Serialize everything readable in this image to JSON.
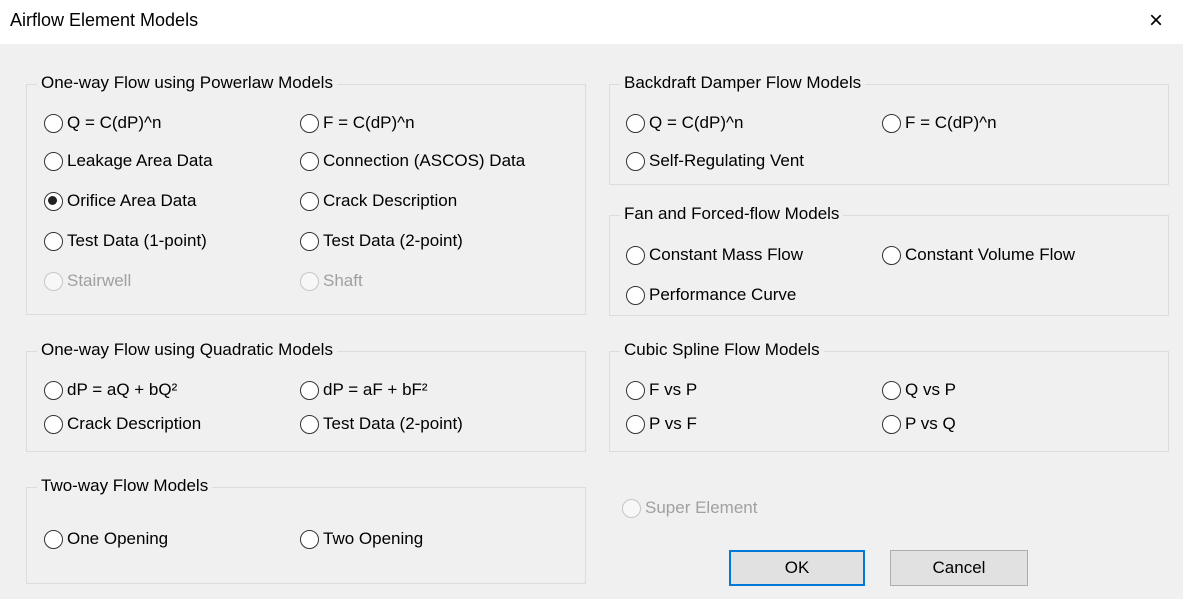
{
  "window": {
    "title": "Airflow Element Models",
    "close_icon": "×"
  },
  "groups": {
    "powerlaw": {
      "title": "One-way Flow using Powerlaw Models",
      "options": [
        {
          "label": "Q = C(dP)^n",
          "checked": false,
          "enabled": true
        },
        {
          "label": "F = C(dP)^n",
          "checked": false,
          "enabled": true
        },
        {
          "label": "Leakage Area Data",
          "checked": false,
          "enabled": true
        },
        {
          "label": "Connection (ASCOS) Data",
          "checked": false,
          "enabled": true
        },
        {
          "label": "Orifice Area Data",
          "checked": true,
          "enabled": true
        },
        {
          "label": "Crack Description",
          "checked": false,
          "enabled": true
        },
        {
          "label": "Test Data (1-point)",
          "checked": false,
          "enabled": true
        },
        {
          "label": "Test Data (2-point)",
          "checked": false,
          "enabled": true
        },
        {
          "label": "Stairwell",
          "checked": false,
          "enabled": false
        },
        {
          "label": "Shaft",
          "checked": false,
          "enabled": false
        }
      ]
    },
    "quadratic": {
      "title": "One-way Flow using Quadratic Models",
      "options": [
        {
          "label": "dP = aQ + bQ²",
          "checked": false,
          "enabled": true
        },
        {
          "label": "dP = aF + bF²",
          "checked": false,
          "enabled": true
        },
        {
          "label": "Crack Description",
          "checked": false,
          "enabled": true
        },
        {
          "label": "Test Data (2-point)",
          "checked": false,
          "enabled": true
        }
      ]
    },
    "twoway": {
      "title": "Two-way Flow Models",
      "options": [
        {
          "label": "One Opening",
          "checked": false,
          "enabled": true
        },
        {
          "label": "Two Opening",
          "checked": false,
          "enabled": true
        }
      ]
    },
    "backdraft": {
      "title": "Backdraft Damper Flow Models",
      "options": [
        {
          "label": "Q = C(dP)^n",
          "checked": false,
          "enabled": true
        },
        {
          "label": "F = C(dP)^n",
          "checked": false,
          "enabled": true
        },
        {
          "label": "Self-Regulating Vent",
          "checked": false,
          "enabled": true
        }
      ]
    },
    "fan": {
      "title": "Fan and Forced-flow Models",
      "options": [
        {
          "label": "Constant Mass Flow",
          "checked": false,
          "enabled": true
        },
        {
          "label": "Constant Volume Flow",
          "checked": false,
          "enabled": true
        },
        {
          "label": "Performance Curve",
          "checked": false,
          "enabled": true
        }
      ]
    },
    "spline": {
      "title": "Cubic Spline Flow Models",
      "options": [
        {
          "label": "F vs P",
          "checked": false,
          "enabled": true
        },
        {
          "label": "Q vs P",
          "checked": false,
          "enabled": true
        },
        {
          "label": "P vs F",
          "checked": false,
          "enabled": true
        },
        {
          "label": "P vs Q",
          "checked": false,
          "enabled": true
        }
      ]
    }
  },
  "super_element": {
    "label": "Super Element",
    "checked": false,
    "enabled": false
  },
  "buttons": {
    "ok": "OK",
    "cancel": "Cancel"
  },
  "colors": {
    "accent": "#0078d7",
    "disabled_text": "#a0a0a0"
  }
}
